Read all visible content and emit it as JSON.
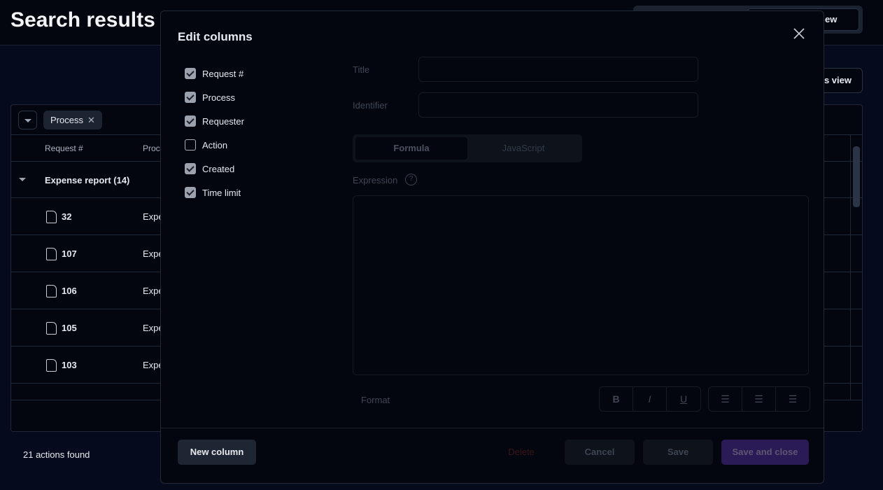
{
  "page": {
    "title": "Search results",
    "view_toggle_label": "ew",
    "view_button_label": "s view",
    "results_count": "21 actions found"
  },
  "table": {
    "filter_chip": "Process",
    "headers": [
      "Request #",
      "Proc"
    ],
    "group": {
      "label": "Expense report (14)"
    },
    "rows": [
      {
        "id": "32",
        "process": "Expe"
      },
      {
        "id": "107",
        "process": "Expe"
      },
      {
        "id": "106",
        "process": "Expe"
      },
      {
        "id": "105",
        "process": "Expe"
      },
      {
        "id": "103",
        "process": "Expe"
      }
    ]
  },
  "modal": {
    "title": "Edit columns",
    "columns": [
      {
        "label": "Request #",
        "checked": true
      },
      {
        "label": "Process",
        "checked": true
      },
      {
        "label": "Requester",
        "checked": true
      },
      {
        "label": "Action",
        "checked": false
      },
      {
        "label": "Created",
        "checked": true
      },
      {
        "label": "Time limit",
        "checked": true
      }
    ],
    "form": {
      "title_label": "Title",
      "title_value": "",
      "identifier_label": "Identifier",
      "identifier_value": "",
      "tabs": [
        "Formula",
        "JavaScript"
      ],
      "active_tab": "Formula",
      "expression_label": "Expression",
      "help": "?",
      "format_label": "Format",
      "format_buttons": [
        "B",
        "I",
        "U"
      ]
    },
    "buttons": {
      "new_column": "New column",
      "delete": "Delete",
      "cancel": "Cancel",
      "save": "Save",
      "save_close": "Save and close"
    }
  },
  "colors": {
    "accent": "#2a1a55",
    "delete": "#3a1518"
  }
}
